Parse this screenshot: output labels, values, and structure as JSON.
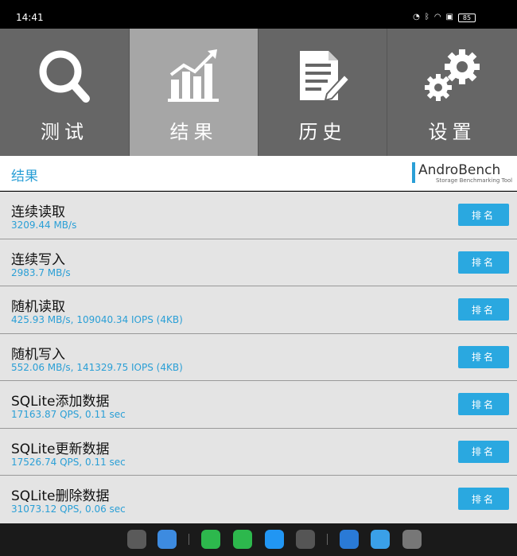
{
  "status": {
    "time": "14:41",
    "battery": "85"
  },
  "tabs": [
    {
      "label": "测试",
      "icon": "search-icon"
    },
    {
      "label": "结果",
      "icon": "chart-icon"
    },
    {
      "label": "历史",
      "icon": "document-edit-icon"
    },
    {
      "label": "设置",
      "icon": "gear-icon"
    }
  ],
  "header": {
    "title": "结果",
    "logo_name": "AndroBench",
    "logo_sub": "Storage Benchmarking Tool"
  },
  "results": [
    {
      "name": "连续读取",
      "value": "3209.44 MB/s",
      "button": "排名"
    },
    {
      "name": "连续写入",
      "value": "2983.7 MB/s",
      "button": "排名"
    },
    {
      "name": "随机读取",
      "value": "425.93 MB/s, 109040.34 IOPS (4KB)",
      "button": "排名"
    },
    {
      "name": "随机写入",
      "value": "552.06 MB/s, 141329.75 IOPS (4KB)",
      "button": "排名"
    },
    {
      "name": "SQLite添加数据",
      "value": "17163.87 QPS, 0.11 sec",
      "button": "排名"
    },
    {
      "name": "SQLite更新数据",
      "value": "17526.74 QPS, 0.11 sec",
      "button": "排名"
    },
    {
      "name": "SQLite删除数据",
      "value": "31073.12 QPS, 0.06 sec",
      "button": "排名"
    }
  ],
  "colors": {
    "accent": "#2a9fd6",
    "tab_bg": "#666666",
    "tab_active_bg": "#a6a6a6",
    "button_bg": "#2aa8e0"
  },
  "dock": [
    {
      "icon": "app-grid-icon",
      "color": "#5a5a5a"
    },
    {
      "icon": "files-icon",
      "color": "#3d8be0"
    },
    {
      "icon": "phone-icon",
      "color": "#2db84d"
    },
    {
      "icon": "messages-icon",
      "color": "#2db84d"
    },
    {
      "icon": "browser-icon",
      "color": "#2196f3"
    },
    {
      "icon": "camera-icon",
      "color": "#555555"
    },
    {
      "icon": "gallery-icon",
      "color": "#2a7ad6"
    },
    {
      "icon": "androbench-icon",
      "color": "#3aa0e8"
    },
    {
      "icon": "settings-icon",
      "color": "#777777"
    }
  ]
}
